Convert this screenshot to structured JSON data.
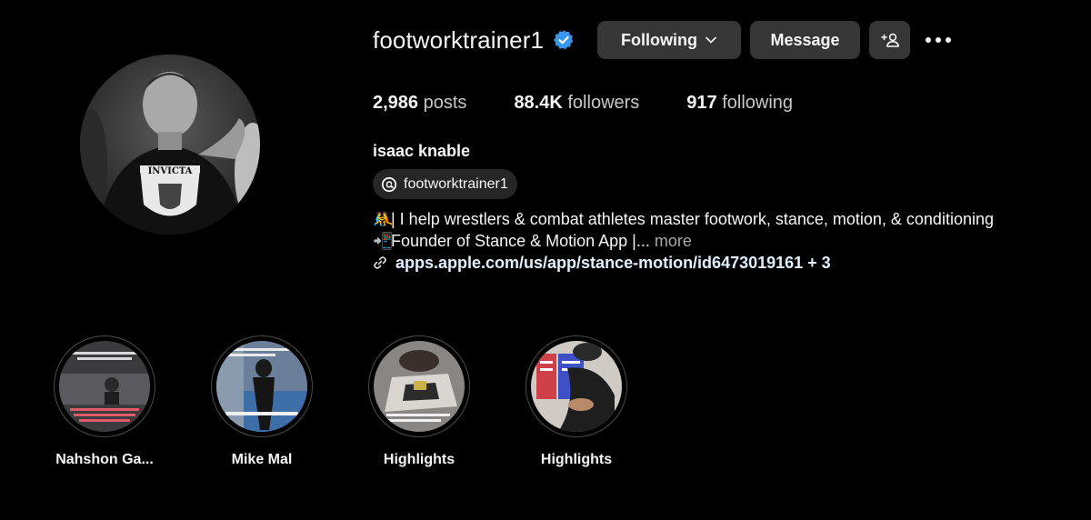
{
  "profile": {
    "username": "footworktrainer1",
    "verified_icon": "verified-badge-icon",
    "following_button": "Following",
    "message_button": "Message",
    "add_user_icon": "add-person-icon",
    "more_icon": "more-horizontal-icon",
    "avatar_icon": "profile-photo"
  },
  "stats": {
    "posts_count": "2,986",
    "posts_label": "posts",
    "followers_count": "88.4K",
    "followers_label": "followers",
    "following_count": "917",
    "following_label": "following"
  },
  "bio": {
    "full_name": "isaac knable",
    "threads_handle": "footworktrainer1",
    "line1_emoji": "🤼",
    "line1": "| I help wrestlers & combat athletes master footwork, stance, motion, & conditioning",
    "line2_emoji": "📲",
    "line2": "Founder of Stance & Motion App |...",
    "more": "more",
    "link": "apps.apple.com/us/app/stance-motion/id6473019161 + 3"
  },
  "highlights": [
    {
      "label": "Nahshon Ga..."
    },
    {
      "label": "Mike Mal"
    },
    {
      "label": "Highlights"
    },
    {
      "label": "Highlights"
    }
  ],
  "colors": {
    "background": "#000000",
    "button": "#363636",
    "verified": "#3797f0",
    "link": "#e0f1ff"
  }
}
